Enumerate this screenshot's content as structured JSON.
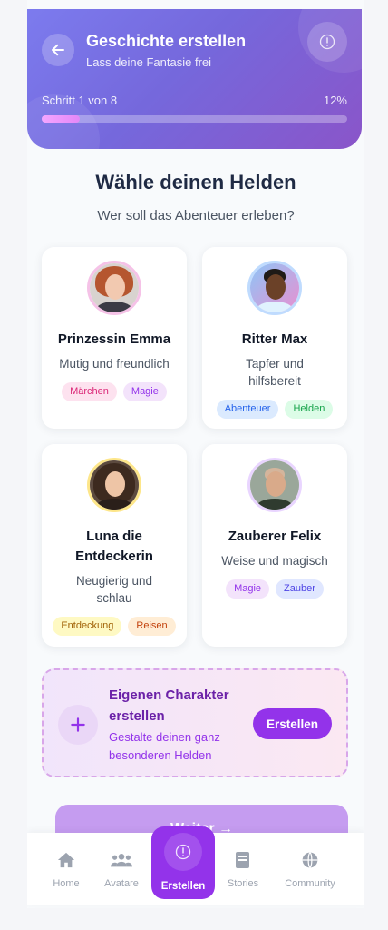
{
  "header": {
    "title": "Geschichte erstellen",
    "subtitle": "Lass deine Fantasie frei",
    "step_text": "Schritt 1 von 8",
    "progress_percent_text": "12%",
    "progress_fraction": 0.125,
    "back_icon": "arrow-left-icon",
    "info_icon": "info-icon"
  },
  "section": {
    "title": "Wähle deinen Helden",
    "subtitle": "Wer soll das Abenteuer erleben?"
  },
  "heroes": [
    {
      "name": "Prinzessin Emma",
      "desc": "Mutig und freundlich",
      "ring": "#f5c2e7",
      "tags": [
        {
          "label": "Märchen",
          "bg": "#fde2ef",
          "fg": "#db2777"
        },
        {
          "label": "Magie",
          "bg": "#f3e3fb",
          "fg": "#9333ea"
        }
      ]
    },
    {
      "name": "Ritter Max",
      "desc": "Tapfer und hilfsbereit",
      "ring": "#bfdbfe",
      "tags": [
        {
          "label": "Abenteuer",
          "bg": "#dbeafe",
          "fg": "#2563eb"
        },
        {
          "label": "Helden",
          "bg": "#dcfce7",
          "fg": "#16a34a"
        }
      ]
    },
    {
      "name": "Luna die Entdeckerin",
      "desc": "Neugierig und schlau",
      "ring": "#fde68a",
      "tags": [
        {
          "label": "Entdeckung",
          "bg": "#fef9c3",
          "fg": "#a16207"
        },
        {
          "label": "Reisen",
          "bg": "#ffedd5",
          "fg": "#c2410c"
        }
      ]
    },
    {
      "name": "Zauberer Felix",
      "desc": "Weise und magisch",
      "ring": "#e9d5ff",
      "tags": [
        {
          "label": "Magie",
          "bg": "#f3e3fb",
          "fg": "#9333ea"
        },
        {
          "label": "Zauber",
          "bg": "#e0e7ff",
          "fg": "#4f46e5"
        }
      ]
    }
  ],
  "custom": {
    "title": "Eigenen Charakter erstellen",
    "desc": "Gestalte deinen ganz besonderen Helden",
    "button": "Erstellen",
    "icon": "plus-icon"
  },
  "next_button": "Weiter →",
  "nav": [
    {
      "label": "Home",
      "icon": "home-icon"
    },
    {
      "label": "Avatare",
      "icon": "users-icon"
    },
    {
      "label": "Erstellen",
      "icon": "info-icon"
    },
    {
      "label": "Stories",
      "icon": "book-icon"
    },
    {
      "label": "Community",
      "icon": "globe-icon"
    }
  ]
}
